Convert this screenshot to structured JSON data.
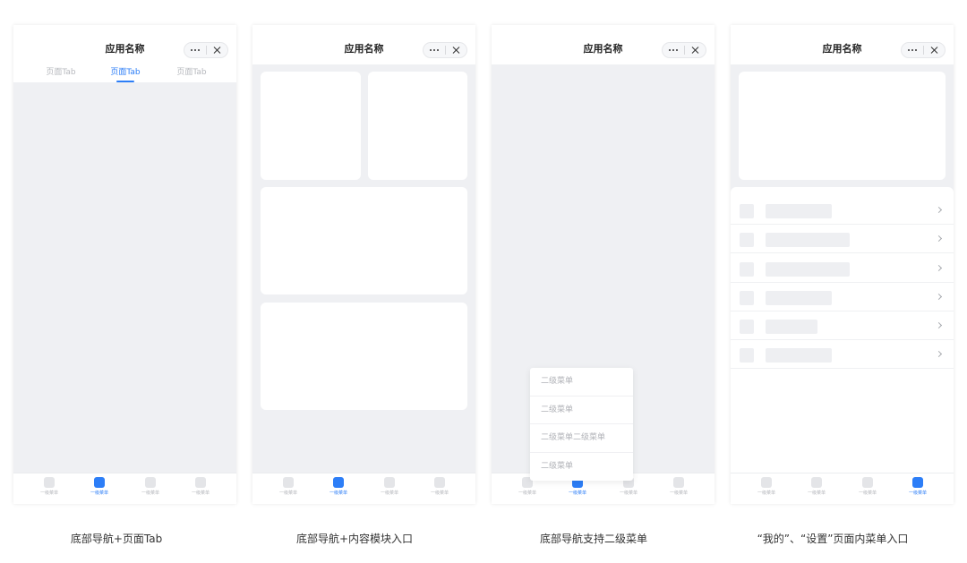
{
  "screens": [
    {
      "app_title": "应用名称",
      "tabs": [
        {
          "label": "页面Tab",
          "active": false
        },
        {
          "label": "页面Tab",
          "active": true
        },
        {
          "label": "页面Tab",
          "active": false
        }
      ],
      "nav": [
        "一级菜单",
        "一级菜单",
        "一级菜单",
        "一级菜单"
      ],
      "active_nav": 1,
      "caption": "底部导航+页面Tab"
    },
    {
      "app_title": "应用名称",
      "nav": [
        "一级菜单",
        "一级菜单",
        "一级菜单",
        "一级菜单"
      ],
      "active_nav": 1,
      "caption": "底部导航+内容模块入口"
    },
    {
      "app_title": "应用名称",
      "submenu": [
        "二级菜单",
        "二级菜单",
        "二级菜单二级菜单",
        "二级菜单"
      ],
      "nav": [
        "一级菜单",
        "一级菜单",
        "一级菜单",
        "一级菜单"
      ],
      "active_nav": 1,
      "caption": "底部导航支持二级菜单"
    },
    {
      "app_title": "应用名称",
      "list_rows": 6,
      "nav": [
        "一级菜单",
        "一级菜单",
        "一级菜单",
        "一级菜单"
      ],
      "active_nav": 3,
      "caption": "“我的”、“设置”页面内菜单入口"
    }
  ],
  "icons": {
    "more": "more-dots-icon",
    "close": "close-icon",
    "chevron": "chevron-right-icon"
  },
  "colors": {
    "accent": "#2d7ef7",
    "page_bg": "#eff0f3",
    "placeholder": "#eeeff2",
    "inactive_text": "#b3b5ba"
  }
}
